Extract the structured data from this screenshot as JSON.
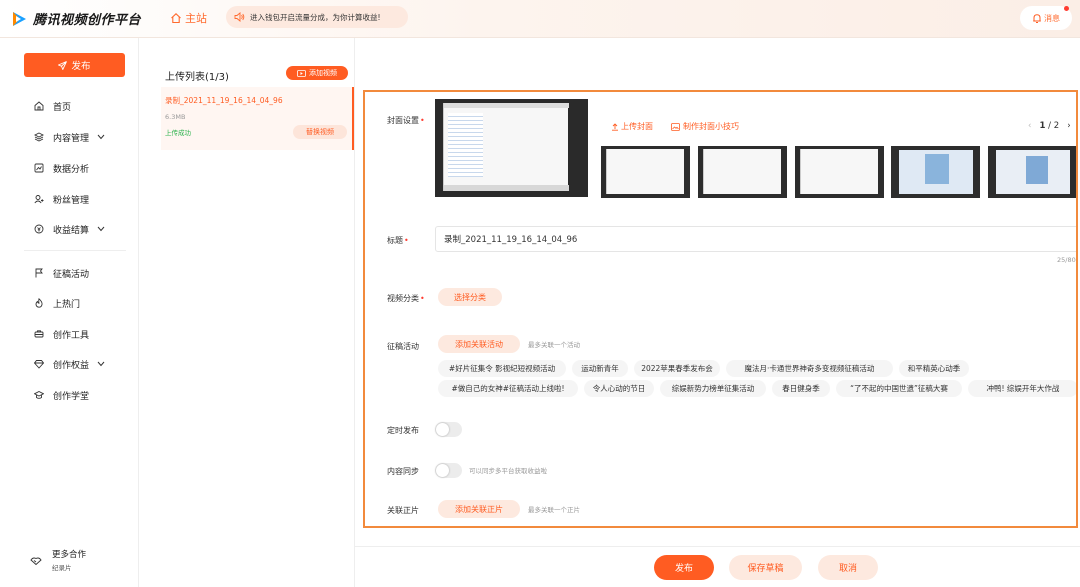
{
  "header": {
    "app_title": "腾讯视频创作平台",
    "home_label": "主站",
    "notice_text": "进入钱包开启流量分成，为你计算收益!",
    "message_label": "消息"
  },
  "sidebar": {
    "publish_label": "发布",
    "items": [
      {
        "label": "首页",
        "icon": "home-icon"
      },
      {
        "label": "内容管理",
        "icon": "layers-icon",
        "expandable": true
      },
      {
        "label": "数据分析",
        "icon": "chart-icon"
      },
      {
        "label": "粉丝管理",
        "icon": "fans-icon"
      },
      {
        "label": "收益结算",
        "icon": "coin-icon",
        "expandable": true
      },
      {
        "label": "征稿活动",
        "icon": "flag-icon"
      },
      {
        "label": "上热门",
        "icon": "fire-icon"
      },
      {
        "label": "创作工具",
        "icon": "tools-icon"
      },
      {
        "label": "创作权益",
        "icon": "diamond-icon",
        "expandable": true
      },
      {
        "label": "创作学堂",
        "icon": "graduation-icon"
      }
    ],
    "more": {
      "title": "更多合作",
      "subtitle": "纪录片"
    }
  },
  "upload_list": {
    "title": "上传列表(1/3)",
    "add_video_label": "添加视频",
    "item": {
      "name": "录制_2021_11_19_16_14_04_96",
      "size": "6.3MB",
      "status": "上传成功",
      "replace_label": "替换视频"
    }
  },
  "form": {
    "cover": {
      "label": "封面设置",
      "upload_label": "上传封面",
      "tips_label": "制作封面小技巧",
      "page_current": "1",
      "page_total": "/ 2"
    },
    "title": {
      "label": "标题",
      "value": "录制_2021_11_19_16_14_04_96",
      "counter": "25/80"
    },
    "category": {
      "label": "视频分类",
      "button": "选择分类"
    },
    "activity": {
      "label": "征稿活动",
      "button": "添加关联活动",
      "hint": "最多关联一个活动",
      "tags_row1": [
        "#好片征集令 影视纪短视频活动",
        "运动新青年",
        "2022苹果春季发布会",
        "魔法月·卡通世界神奇多变视频征稿活动",
        "和平精英心动季"
      ],
      "tags_row2": [
        "#做自己的女神#征稿活动上线啦!",
        "令人心动的节日",
        "综娱新势力榜单征集活动",
        "春日健身季",
        "“了不起的中国世遗”征稿大赛",
        "冲鸭! 综娱开年大作战"
      ]
    },
    "schedule": {
      "label": "定时发布"
    },
    "sync": {
      "label": "内容同步",
      "hint": "可以同步多平台获取收益啦"
    },
    "related": {
      "label": "关联正片",
      "button": "添加关联正片",
      "hint": "最多关联一个正片"
    }
  },
  "footer": {
    "publish": "发布",
    "save_draft": "保存草稿",
    "cancel": "取消"
  },
  "colors": {
    "accent": "#ff5c22",
    "success": "#2bb24c",
    "form_border": "#f28a3c"
  }
}
